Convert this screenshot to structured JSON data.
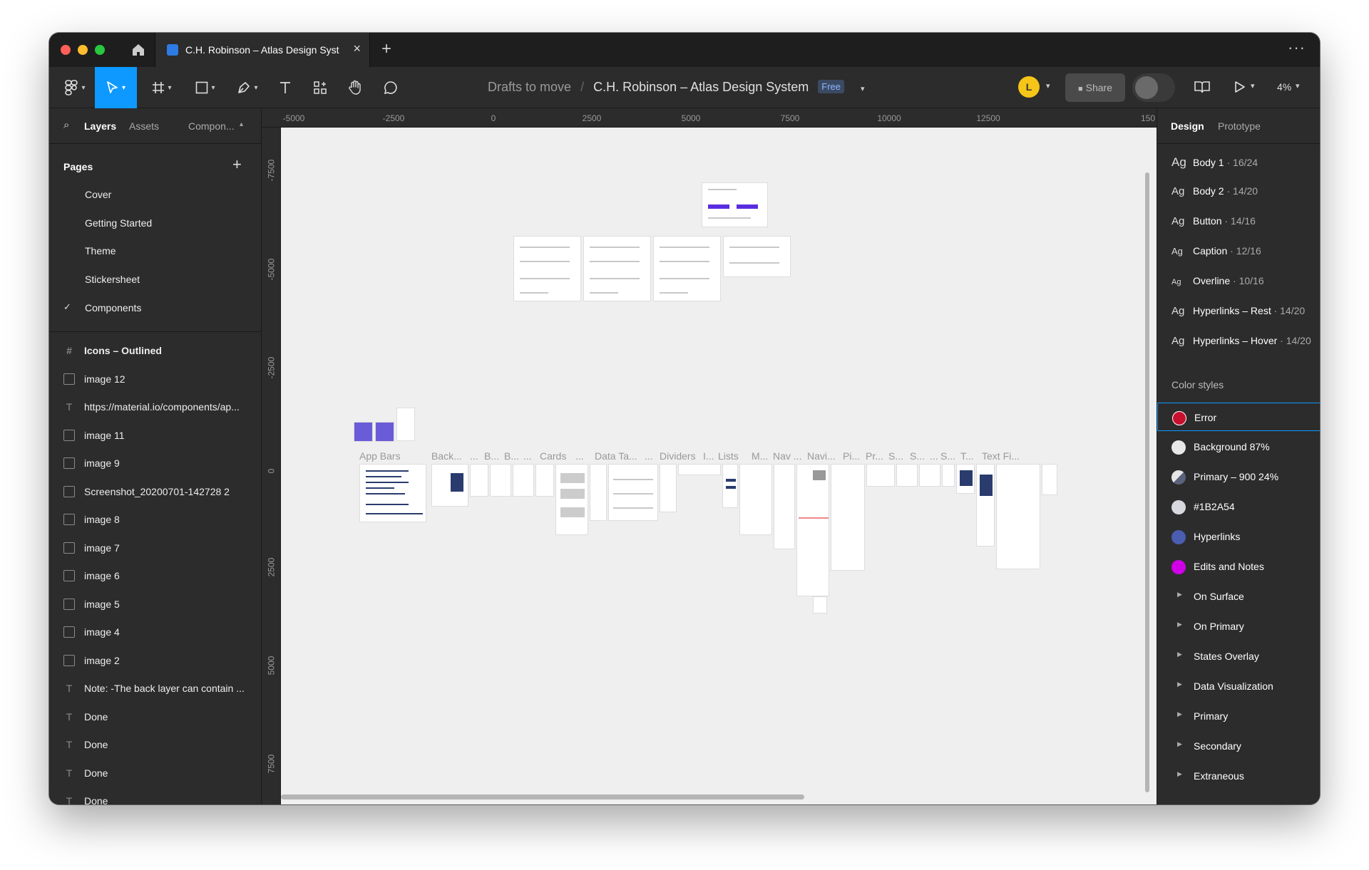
{
  "window": {
    "tab_title": "C.H. Robinson – Atlas Design Syst​",
    "more_label": "···"
  },
  "toolbar": {
    "crumb_folder": "Drafts to move",
    "crumb_sep": "/",
    "file_name": "C.H. Robinson – Atlas Design System",
    "plan_badge": "Free",
    "avatar_initial": "L",
    "share_label": "Share",
    "zoom_label": "4%",
    "accent": "#0d99ff"
  },
  "left_panel": {
    "tabs": [
      "Layers",
      "Assets",
      "Compon..."
    ],
    "pages_title": "Pages",
    "pages": [
      "Cover",
      "Getting Started",
      "Theme",
      "Stickersheet",
      "Components"
    ],
    "current_page": "Components",
    "layers": [
      {
        "icon": "frame-icon",
        "label": "Icons – Outlined"
      },
      {
        "icon": "image-icon",
        "label": "image 12"
      },
      {
        "icon": "text-icon",
        "label": "https://material.io/components/ap..."
      },
      {
        "icon": "image-icon",
        "label": "image 11"
      },
      {
        "icon": "image-icon",
        "label": "image 9"
      },
      {
        "icon": "image-icon",
        "label": "Screenshot_20200701-142728 2"
      },
      {
        "icon": "image-icon",
        "label": "image 8"
      },
      {
        "icon": "image-icon",
        "label": "image 7"
      },
      {
        "icon": "image-icon",
        "label": "image 6"
      },
      {
        "icon": "image-icon",
        "label": "image 5"
      },
      {
        "icon": "image-icon",
        "label": "image 4"
      },
      {
        "icon": "image-icon",
        "label": "image 2"
      },
      {
        "icon": "text-icon",
        "label": "Note: -The back layer can contain ..."
      },
      {
        "icon": "text-icon",
        "label": "Done"
      },
      {
        "icon": "text-icon",
        "label": "Done"
      },
      {
        "icon": "text-icon",
        "label": "Done"
      },
      {
        "icon": "text-icon",
        "label": "Done"
      }
    ]
  },
  "rulers": {
    "top": [
      "-5000",
      "-2500",
      "0",
      "2500",
      "5000",
      "7500",
      "10000",
      "12500",
      "150"
    ],
    "left": [
      "-7500",
      "-5000",
      "-2500",
      "0",
      "2500",
      "5000",
      "7500"
    ]
  },
  "canvas": {
    "frame_labels": [
      "App Bars",
      "Back...",
      "...",
      "B...",
      "B...",
      "...",
      "Cards",
      "...",
      "Data Ta...",
      "...",
      "Dividers",
      "I...",
      "Lists",
      "M...",
      "Nav ...",
      "Navi...",
      "Pi...",
      "Pr...",
      "S...",
      "S...",
      "...",
      "S...",
      "T...",
      "Text Fi..."
    ]
  },
  "right_panel": {
    "tabs": [
      "Design",
      "Prototype"
    ],
    "text_styles": [
      {
        "name": "Body 1",
        "meta": "· 16/24"
      },
      {
        "name": "Body 2",
        "meta": "· 14/20"
      },
      {
        "name": "Button",
        "meta": "· 14/16"
      },
      {
        "name": "Caption",
        "meta": "· 12/16"
      },
      {
        "name": "Overline",
        "meta": "· 10/16"
      },
      {
        "name": "Hyperlinks – Rest",
        "meta": "· 14/20"
      },
      {
        "name": "Hyperlinks – Hover",
        "meta": "· 14/20"
      }
    ],
    "ag_glyph": "Ag",
    "color_styles_title": "Color styles",
    "color_styles": [
      {
        "name": "Error",
        "color": "#c8102e"
      },
      {
        "name": "Background 87%",
        "color": "#ffffff"
      },
      {
        "name": "Primary – 900 24%",
        "color": "#1b2a54"
      },
      {
        "name": "#1B2A54",
        "color": "#e6e6e6"
      },
      {
        "name": "Hyperlinks",
        "color": "#4a5db0"
      },
      {
        "name": "Edits and Notes",
        "color": "#d000e8"
      }
    ],
    "color_groups": [
      "On Surface",
      "On Primary",
      "States Overlay",
      "Data Visualization",
      "Primary",
      "Secondary",
      "Extraneous"
    ],
    "help_label": "?"
  }
}
